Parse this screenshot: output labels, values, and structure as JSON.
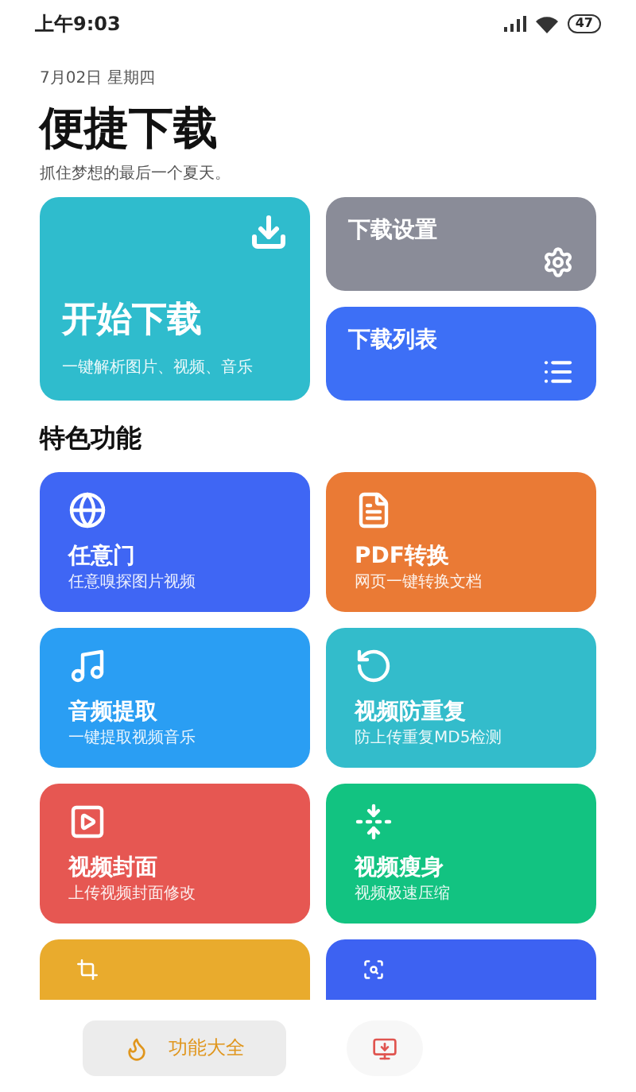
{
  "status_bar": {
    "time": "上午9:03",
    "battery": "47"
  },
  "header": {
    "date": "7月02日 星期四",
    "title": "便捷下载",
    "subtitle": "抓住梦想的最后一个夏天。"
  },
  "main_cards": [
    {
      "title": "开始下载",
      "subtitle": "一键解析图片、视频、音乐",
      "color": "#2fbccd"
    },
    {
      "title": "下载设置",
      "color": "#8a8c98"
    },
    {
      "title": "下载列表",
      "color": "#3d6ff6"
    }
  ],
  "section_title": "特色功能",
  "features": [
    {
      "title": "任意门",
      "subtitle": "任意嗅探图片视频",
      "color": "#3f66f4"
    },
    {
      "title": "PDF转换",
      "subtitle": "网页一键转换文档",
      "color": "#ea7a35"
    },
    {
      "title": "音频提取",
      "subtitle": "一键提取视频音乐",
      "color": "#2a9ef3"
    },
    {
      "title": "视频防重复",
      "subtitle": "防上传重复MD5检测",
      "color": "#33bccb"
    },
    {
      "title": "视频封面",
      "subtitle": "上传视频封面修改",
      "color": "#e65752"
    },
    {
      "title": "视频瘦身",
      "subtitle": "视频极速压缩",
      "color": "#12c381"
    },
    {
      "color": "#e9ab2d",
      "kind": "cut"
    },
    {
      "color": "#3d62f2",
      "kind": "cut"
    }
  ],
  "bottom_nav": [
    {
      "label": "功能大全",
      "selected": true
    },
    {
      "selected": false
    }
  ]
}
